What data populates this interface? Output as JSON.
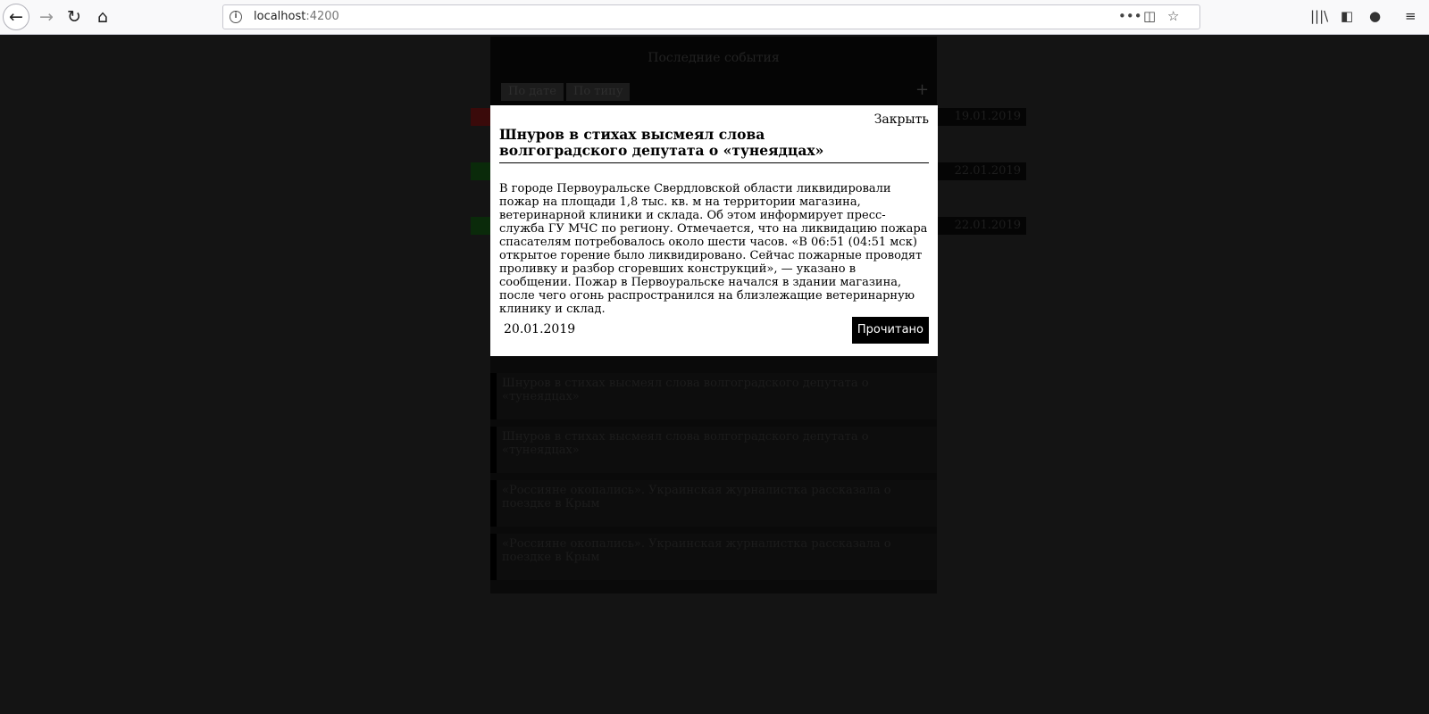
{
  "browser": {
    "url_host": "localhost",
    "url_port": ":4200"
  },
  "background_page": {
    "panel_title": "Последние события",
    "sort_by_date": "По дате",
    "sort_by_type": "По типу",
    "add_symbol": "+",
    "events": [
      {
        "date": "19.01.2019",
        "marker_color": "#3a0a0a"
      },
      {
        "date": "22.01.2019",
        "marker_color": "#0a2a0a"
      },
      {
        "date": "22.01.2019",
        "marker_color": "#0a2a0a"
      }
    ],
    "news": [
      {
        "title": "Шнуров в стихах высмеял слова волгоградского депутата о «тунеядцах»"
      },
      {
        "title": "Шнуров в стихах высмеял слова волгоградского депутата о «тунеядцах»"
      },
      {
        "title": "«Россияне окопались». Украинская журналистка рассказала о поездке в Крым"
      },
      {
        "title": "«Россияне окопались». Украинская журналистка рассказала о поездке в Крым"
      }
    ]
  },
  "modal": {
    "close_label": "Закрыть",
    "title": "Шнуров в стихах высмеял слова волгоградского депутата о «тунеядцах»",
    "body": "В городе Первоуральске Свердловской области ликвидировали пожар на площади 1,8 тыс. кв. м на территории магазина, ветеринарной клиники и склада. Об этом информирует пресс-служба ГУ МЧС по региону. Отмечается, что на ликвидацию пожара спасателям потребовалось около шести часов. «В 06:51 (04:51 мск) открытое горение было ликвидировано. Сейчас пожарные проводят проливку и разбор сгоревших конструкций», — указано в сообщении. Пожар в Первоуральске начался в здании магазина, после чего огонь распространился на близлежащие ветеринарную клинику и склад.",
    "date": "20.01.2019",
    "read_button": "Прочитано"
  }
}
